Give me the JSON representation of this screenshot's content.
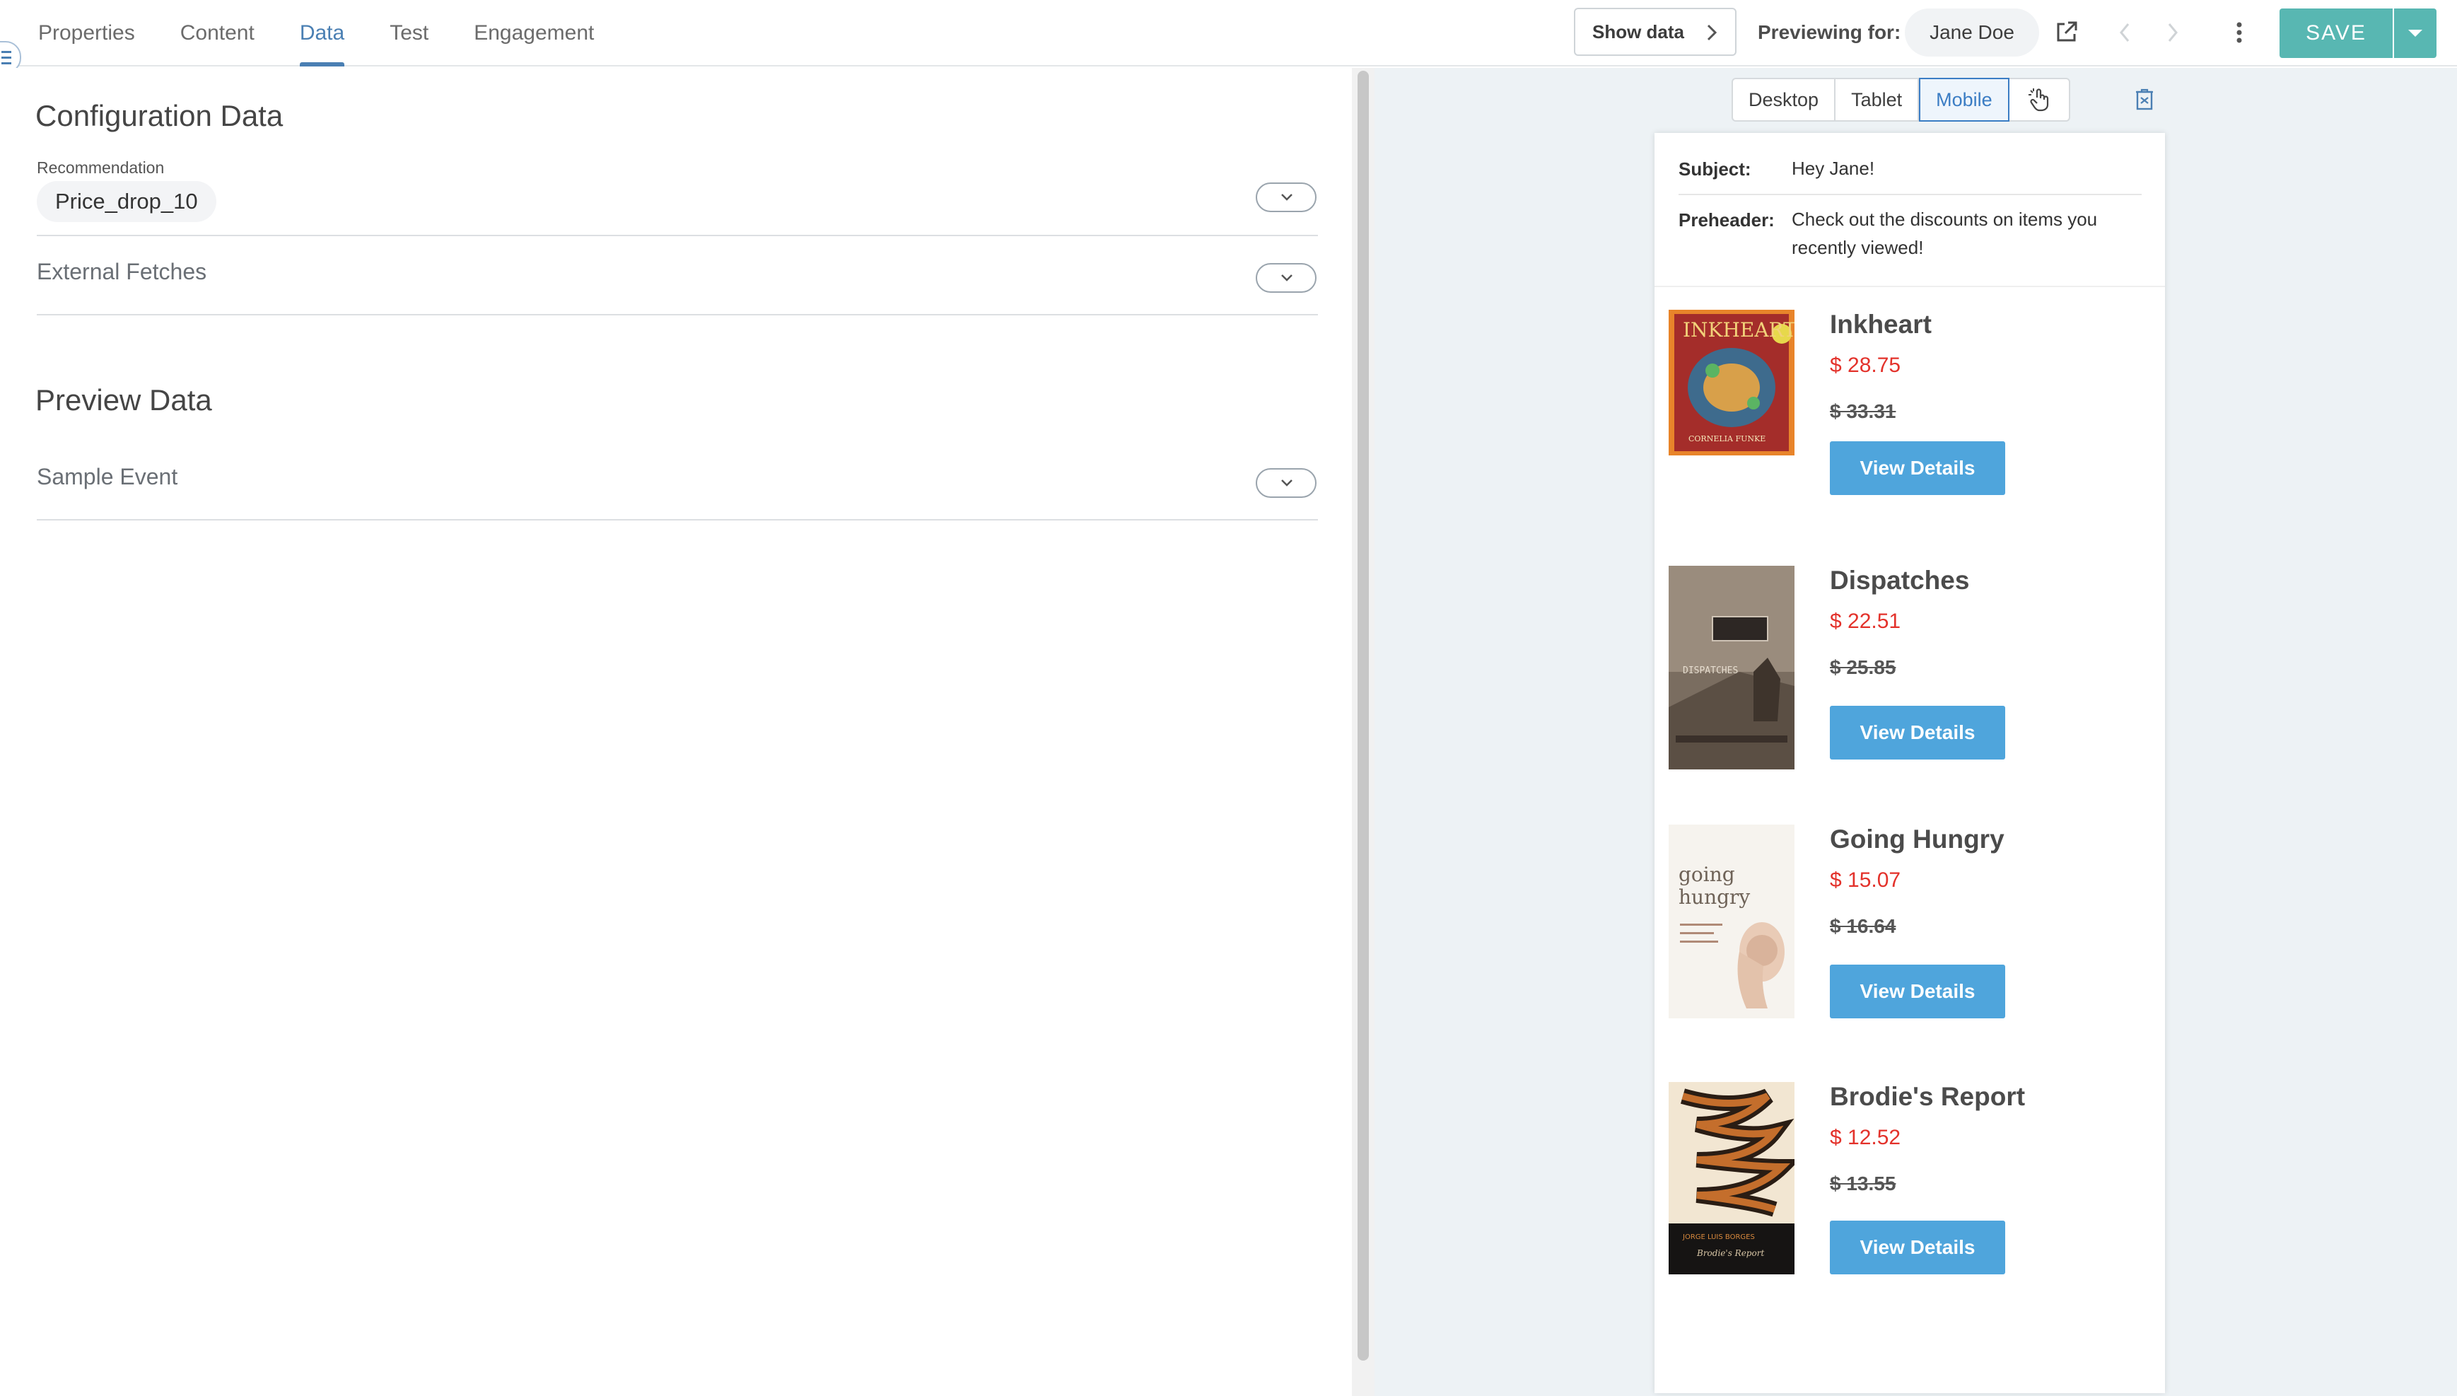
{
  "tabs": [
    {
      "label": "Properties"
    },
    {
      "label": "Content"
    },
    {
      "label": "Data"
    },
    {
      "label": "Test"
    },
    {
      "label": "Engagement"
    }
  ],
  "active_tab": "Data",
  "toolbar": {
    "show_data_label": "Show data",
    "previewing_label": "Previewing for:",
    "persona": "Jane Doe",
    "save_label": "SAVE"
  },
  "config": {
    "title": "Configuration Data",
    "recommendation_label": "Recommendation",
    "recommendation_value": "Price_drop_10",
    "external_fetches_label": "External Fetches"
  },
  "preview_data": {
    "title": "Preview Data",
    "sample_event_label": "Sample Event"
  },
  "devices": [
    {
      "label": "Desktop"
    },
    {
      "label": "Tablet"
    },
    {
      "label": "Mobile"
    }
  ],
  "active_device": "Mobile",
  "email": {
    "subject_key": "Subject:",
    "subject_value": "Hey Jane!",
    "preheader_key": "Preheader:",
    "preheader_value": "Check out the discounts on items you recently viewed!",
    "cta_label": "View Details",
    "products": [
      {
        "title": "Inkheart",
        "price": "$ 28.75",
        "original_price": "$ 33.31"
      },
      {
        "title": "Dispatches",
        "price": "$ 22.51",
        "original_price": "$ 25.85"
      },
      {
        "title": "Going Hungry",
        "price": "$ 15.07",
        "original_price": "$ 16.64"
      },
      {
        "title": "Brodie's Report",
        "price": "$ 12.52",
        "original_price": "$ 13.55"
      }
    ],
    "cover_text": {
      "inkheart_title": "INKHEART",
      "inkheart_author": "CORNELIA FUNKE",
      "dispatches_title": "DISPATCHES",
      "going_hungry_line1": "going",
      "going_hungry_line2": "hungry",
      "brodie_author": "JORGE LUIS BORGES",
      "brodie_title": "Brodie's Report"
    }
  },
  "colors": {
    "accent": "#4a7fb3",
    "save": "#58b7b2",
    "price_red": "#e3322b",
    "cta_blue": "#4fa5dc",
    "preview_bg": "#edf2f5"
  }
}
